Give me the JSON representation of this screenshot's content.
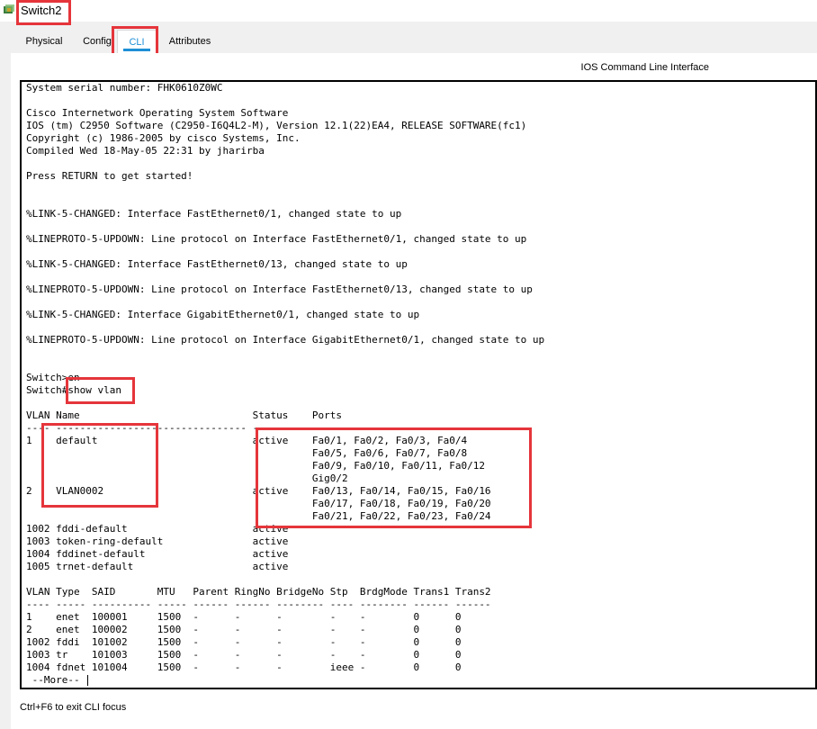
{
  "window": {
    "title": "Switch2"
  },
  "tabs": [
    {
      "label": "Physical"
    },
    {
      "label": "Config"
    },
    {
      "label": "CLI"
    },
    {
      "label": "Attributes"
    }
  ],
  "panel": {
    "title": "IOS Command Line Interface"
  },
  "terminal": {
    "lines": [
      "System serial number: FHK0610Z0WC",
      "",
      "Cisco Internetwork Operating System Software",
      "IOS (tm) C2950 Software (C2950-I6Q4L2-M), Version 12.1(22)EA4, RELEASE SOFTWARE(fc1)",
      "Copyright (c) 1986-2005 by cisco Systems, Inc.",
      "Compiled Wed 18-May-05 22:31 by jharirba",
      "",
      "Press RETURN to get started!",
      "",
      "",
      "%LINK-5-CHANGED: Interface FastEthernet0/1, changed state to up",
      "",
      "%LINEPROTO-5-UPDOWN: Line protocol on Interface FastEthernet0/1, changed state to up",
      "",
      "%LINK-5-CHANGED: Interface FastEthernet0/13, changed state to up",
      "",
      "%LINEPROTO-5-UPDOWN: Line protocol on Interface FastEthernet0/13, changed state to up",
      "",
      "%LINK-5-CHANGED: Interface GigabitEthernet0/1, changed state to up",
      "",
      "%LINEPROTO-5-UPDOWN: Line protocol on Interface GigabitEthernet0/1, changed state to up",
      "",
      "",
      "Switch>en",
      "Switch#show vlan",
      "",
      "VLAN Name                             Status    Ports",
      "---- -------------------------------- --------- -------------------------------",
      "1    default                          active    Fa0/1, Fa0/2, Fa0/3, Fa0/4",
      "                                                Fa0/5, Fa0/6, Fa0/7, Fa0/8",
      "                                                Fa0/9, Fa0/10, Fa0/11, Fa0/12",
      "                                                Gig0/2",
      "2    VLAN0002                         active    Fa0/13, Fa0/14, Fa0/15, Fa0/16",
      "                                                Fa0/17, Fa0/18, Fa0/19, Fa0/20",
      "                                                Fa0/21, Fa0/22, Fa0/23, Fa0/24",
      "1002 fddi-default                     active",
      "1003 token-ring-default               active",
      "1004 fddinet-default                  active",
      "1005 trnet-default                    active",
      "",
      "VLAN Type  SAID       MTU   Parent RingNo BridgeNo Stp  BrdgMode Trans1 Trans2",
      "---- ----- ---------- ----- ------ ------ -------- ---- -------- ------ ------",
      "1    enet  100001     1500  -      -      -        -    -        0      0",
      "2    enet  100002     1500  -      -      -        -    -        0      0",
      "1002 fddi  101002     1500  -      -      -        -    -        0      0",
      "1003 tr    101003     1500  -      -      -        -    -        0      0",
      "1004 fdnet 101004     1500  -      -      -        ieee -        0      0"
    ],
    "more_prompt": " --More-- "
  },
  "footer": {
    "hint": "Ctrl+F6 to exit CLI focus"
  },
  "colors": {
    "highlight": "#e5353b",
    "tab_active_underline": "#1e8fd6"
  }
}
